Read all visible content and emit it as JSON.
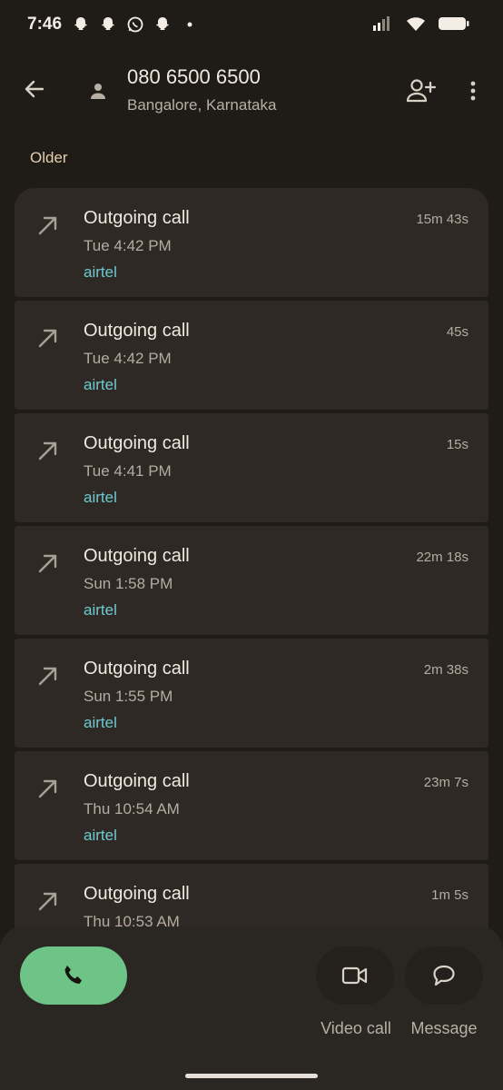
{
  "status_bar": {
    "time": "7:46",
    "notification_icons": [
      "snapchat-icon",
      "snapchat-icon",
      "whatsapp-icon",
      "snapchat-icon",
      "dot-icon"
    ],
    "system_icons": [
      "signal-icon",
      "wifi-icon",
      "battery-icon"
    ]
  },
  "header": {
    "number": "080 6500 6500",
    "location": "Bangalore, Karnataka"
  },
  "section_label": "Older",
  "calls": [
    {
      "type": "Outgoing call",
      "time": "Tue 4:42 PM",
      "carrier": "airtel",
      "duration": "15m 43s"
    },
    {
      "type": "Outgoing call",
      "time": "Tue 4:42 PM",
      "carrier": "airtel",
      "duration": "45s"
    },
    {
      "type": "Outgoing call",
      "time": "Tue 4:41 PM",
      "carrier": "airtel",
      "duration": "15s"
    },
    {
      "type": "Outgoing call",
      "time": "Sun 1:58 PM",
      "carrier": "airtel",
      "duration": "22m 18s"
    },
    {
      "type": "Outgoing call",
      "time": "Sun 1:55 PM",
      "carrier": "airtel",
      "duration": "2m 38s"
    },
    {
      "type": "Outgoing call",
      "time": "Thu 10:54 AM",
      "carrier": "airtel",
      "duration": "23m 7s"
    },
    {
      "type": "Outgoing call",
      "time": "Thu 10:53 AM",
      "carrier": "",
      "duration": "1m 5s"
    }
  ],
  "actions": {
    "video_label": "Video call",
    "message_label": "Message"
  },
  "colors": {
    "background": "#1f1c18",
    "card": "#2e2924",
    "carrier": "#6fc9d3",
    "call_button": "#6ec487",
    "section_label": "#e4cfae"
  }
}
